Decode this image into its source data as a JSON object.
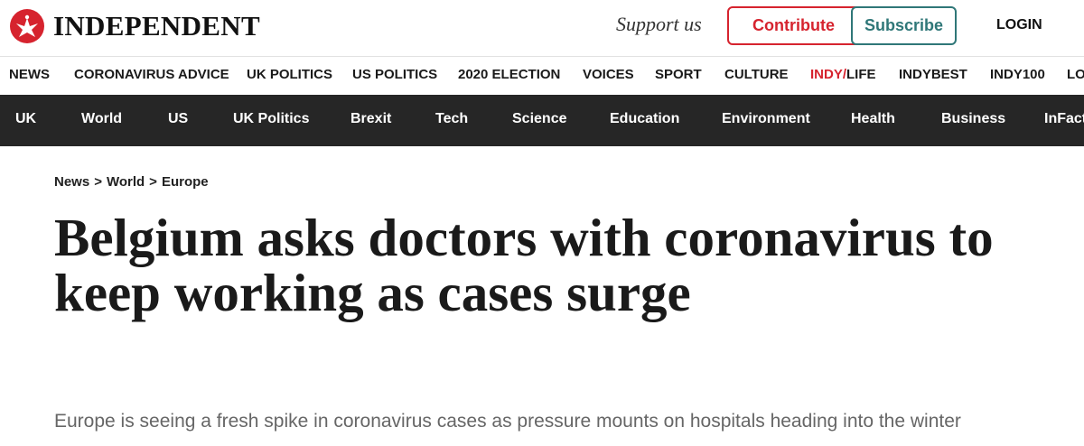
{
  "header": {
    "logo_text": "INDEPENDENT",
    "support_text": "Support us",
    "contribute_label": "Contribute",
    "subscribe_label": "Subscribe",
    "login_label": "LOGIN"
  },
  "primary_nav": {
    "items": [
      {
        "label": "NEWS"
      },
      {
        "label": "CORONAVIRUS ADVICE"
      },
      {
        "label": "UK POLITICS"
      },
      {
        "label": "US POLITICS"
      },
      {
        "label": "2020 ELECTION"
      },
      {
        "label": "VOICES"
      },
      {
        "label": "SPORT"
      },
      {
        "label": "CULTURE"
      },
      {
        "label_a": "INDY/",
        "label_b": "LIFE"
      },
      {
        "label": "INDYBEST"
      },
      {
        "label": "INDY100"
      },
      {
        "label": "LO"
      }
    ]
  },
  "secondary_nav": {
    "items": [
      {
        "label": "UK"
      },
      {
        "label": "World"
      },
      {
        "label": "US"
      },
      {
        "label": "UK Politics"
      },
      {
        "label": "Brexit"
      },
      {
        "label": "Tech"
      },
      {
        "label": "Science"
      },
      {
        "label": "Education"
      },
      {
        "label": "Environment"
      },
      {
        "label": "Health"
      },
      {
        "label": "Business"
      },
      {
        "label": "InFact"
      }
    ]
  },
  "breadcrumb": {
    "items": [
      {
        "label": "News"
      },
      {
        "label": "World"
      },
      {
        "label": "Europe"
      }
    ],
    "separator": ">"
  },
  "article": {
    "headline": "Belgium asks doctors with coronavirus to keep working as cases surge",
    "standfirst": "Europe is seeing a fresh spike in coronavirus cases as pressure mounts on hospitals heading into the winter"
  },
  "colors": {
    "brand_red": "#d6232e",
    "subscribe_teal": "#2f7778",
    "section_bar": "#262626"
  },
  "icons": {
    "logo": "eagle-logo-icon"
  }
}
